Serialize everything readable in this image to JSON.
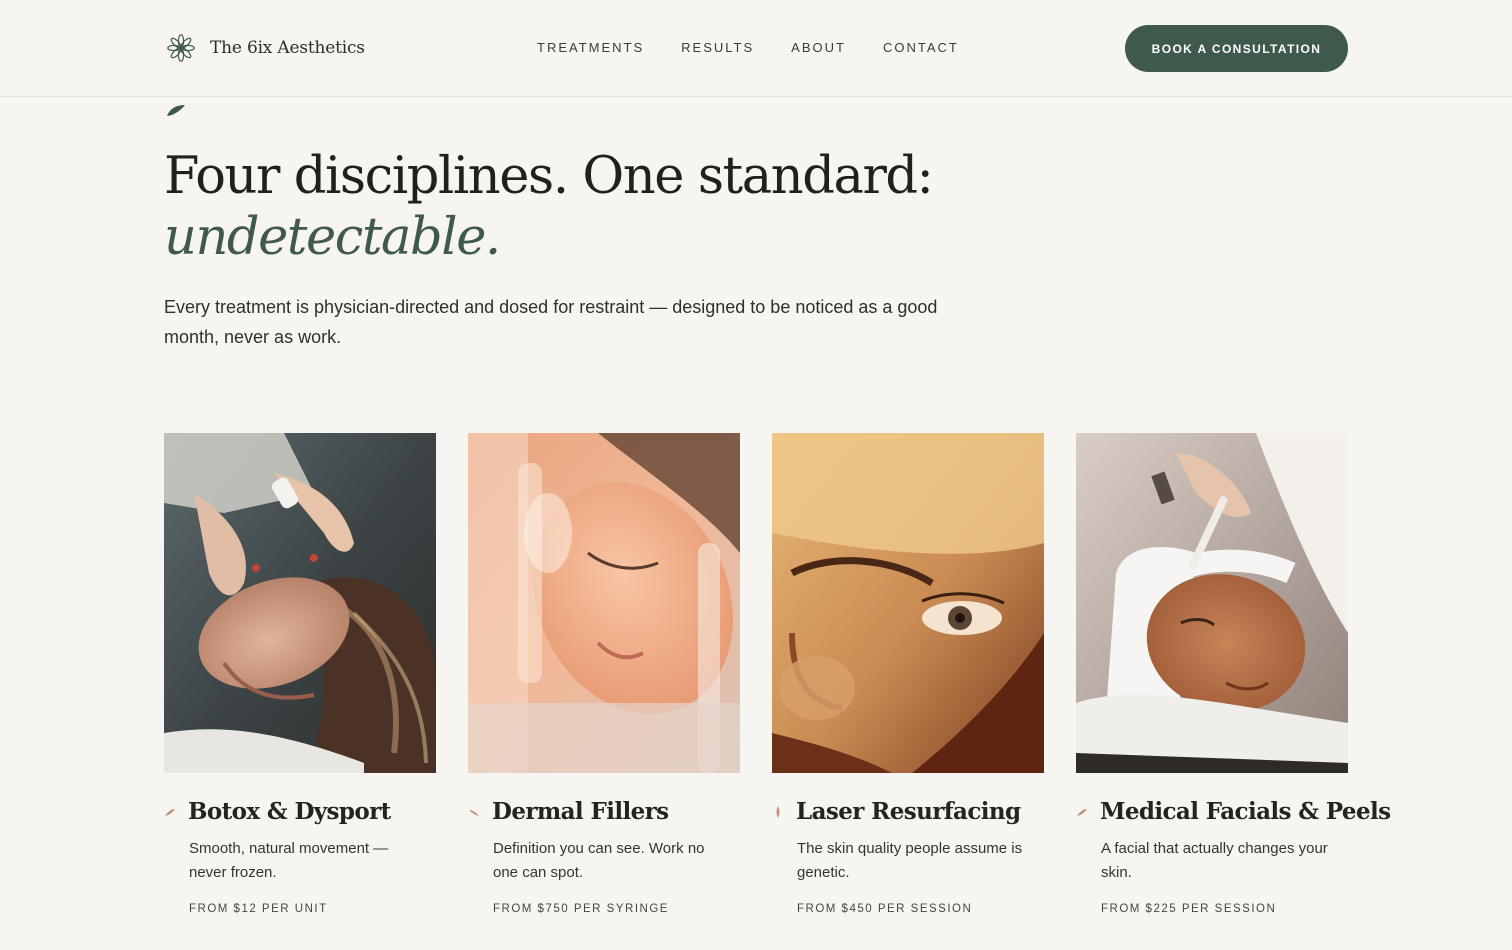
{
  "header": {
    "brand_name": "The 6ix Aesthetics",
    "brand_icon": "asterisk-flower-icon",
    "nav": [
      {
        "label": "TREATMENTS"
      },
      {
        "label": "RESULTS"
      },
      {
        "label": "ABOUT"
      },
      {
        "label": "CONTACT"
      }
    ],
    "cta_label": "BOOK A CONSULTATION"
  },
  "hero": {
    "headline": "Four disciplines. One standard:",
    "headline_accent": "undetectable.",
    "intro": "Every treatment is physician-directed and dosed for restraint — designed to be noticed as a good month, never as work."
  },
  "treatments": [
    {
      "title": "Botox & Dysport",
      "description": "Smooth, natural movement — never frozen.",
      "price": "FROM $12 PER UNIT"
    },
    {
      "title": "Dermal Fillers",
      "description": "Definition you can see. Work no one can spot.",
      "price": "FROM $750 PER SYRINGE"
    },
    {
      "title": "Laser Resurfacing",
      "description": "The skin quality people assume is genetic.",
      "price": "FROM $450 PER SESSION"
    },
    {
      "title": "Medical Facials & Peels",
      "description": "A facial that actually changes your skin.",
      "price": "FROM $225 PER SESSION"
    }
  ],
  "colors": {
    "background": "#f7f5f1",
    "brand_green": "#3f5a4c",
    "accent_copper": "#c2967a",
    "text": "#23241f"
  }
}
